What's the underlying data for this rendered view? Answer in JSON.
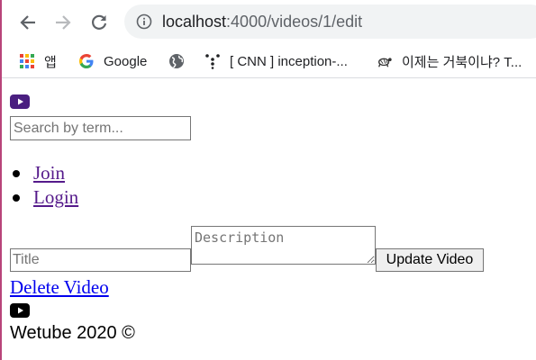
{
  "browser": {
    "url_host": "localhost",
    "url_path": ":4000/videos/1/edit",
    "bookmarks": [
      {
        "label": "앱",
        "icon": "apps-grid-icon"
      },
      {
        "label": "Google",
        "icon": "google-g-icon"
      },
      {
        "label": "",
        "icon": "globe-icon"
      },
      {
        "label": "[ CNN ] inception-...",
        "icon": "dots-logo-icon"
      },
      {
        "label": "이제는 거북이냐? T...",
        "icon": "turtle-icon"
      }
    ]
  },
  "page": {
    "search_placeholder": "Search by term...",
    "nav": [
      {
        "label": "Join"
      },
      {
        "label": "Login"
      }
    ],
    "form": {
      "title_placeholder": "Title",
      "description_placeholder": "Description",
      "submit_label": "Update Video"
    },
    "delete_label": "Delete Video",
    "footer": "Wetube 2020 ©",
    "logo_color_visited": "#4a1f80",
    "logo_color": "#000000"
  }
}
